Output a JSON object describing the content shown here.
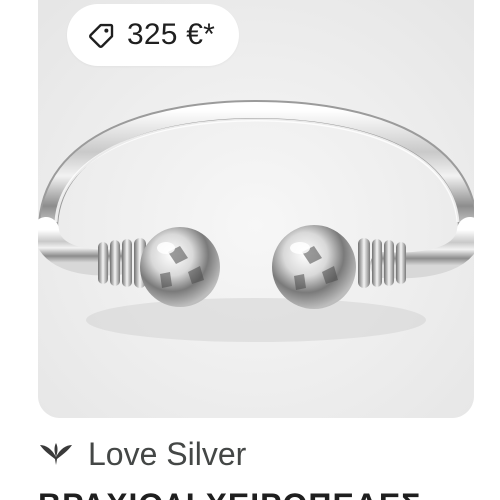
{
  "product": {
    "price": "325 €*",
    "price_icon": "price-tag-icon",
    "image_subject": "hammered silver open cuff bangle with ball ends",
    "brand": {
      "name": "Love Silver",
      "logo_icon": "love-silver-logo-icon"
    },
    "title_partial": "ΒΡΑΧΙΟΛΙ ΧΕΙΡΟΠΕΔΕΣ"
  },
  "colors": {
    "card_background": "#ececec",
    "pill_background": "#ffffff",
    "text_primary": "#1f1f1f",
    "text_secondary": "#444746"
  }
}
